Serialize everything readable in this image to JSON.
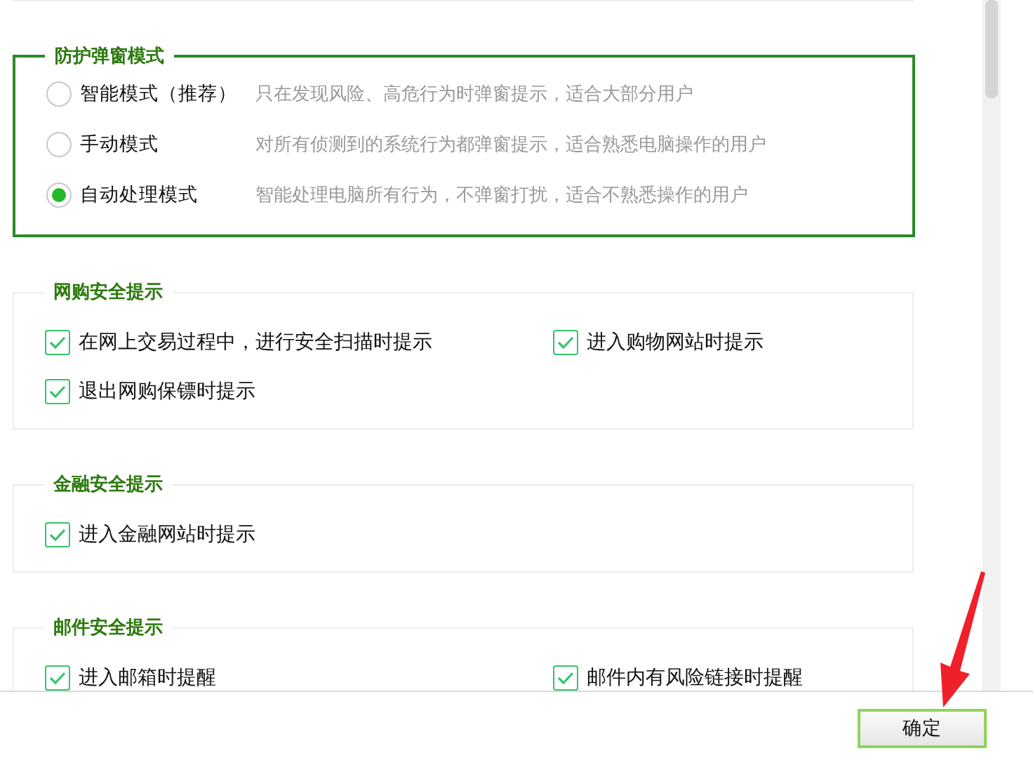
{
  "protection_mode": {
    "title": "防护弹窗模式",
    "options": [
      {
        "label": "智能模式（推荐）",
        "description": "只在发现风险、高危行为时弹窗提示，适合大部分用户",
        "selected": false
      },
      {
        "label": "手动模式",
        "description": "对所有侦测到的系统行为都弹窗提示，适合熟悉电脑操作的用户",
        "selected": false
      },
      {
        "label": "自动处理模式",
        "description": "智能处理电脑所有行为，不弹窗打扰，适合不熟悉操作的用户",
        "selected": true
      }
    ]
  },
  "sections": [
    {
      "title": "网购安全提示",
      "items": [
        {
          "label": "在网上交易过程中，进行安全扫描时提示",
          "checked": true
        },
        {
          "label": "进入购物网站时提示",
          "checked": true
        },
        {
          "label": "退出网购保镖时提示",
          "checked": true
        }
      ]
    },
    {
      "title": "金融安全提示",
      "items": [
        {
          "label": "进入金融网站时提示",
          "checked": true
        }
      ]
    },
    {
      "title": "邮件安全提示",
      "items": [
        {
          "label": "进入邮箱时提醒",
          "checked": true
        },
        {
          "label": "邮件内有风险链接时提醒",
          "checked": true
        }
      ]
    }
  ],
  "buttons": [
    {
      "label": "确定"
    }
  ]
}
